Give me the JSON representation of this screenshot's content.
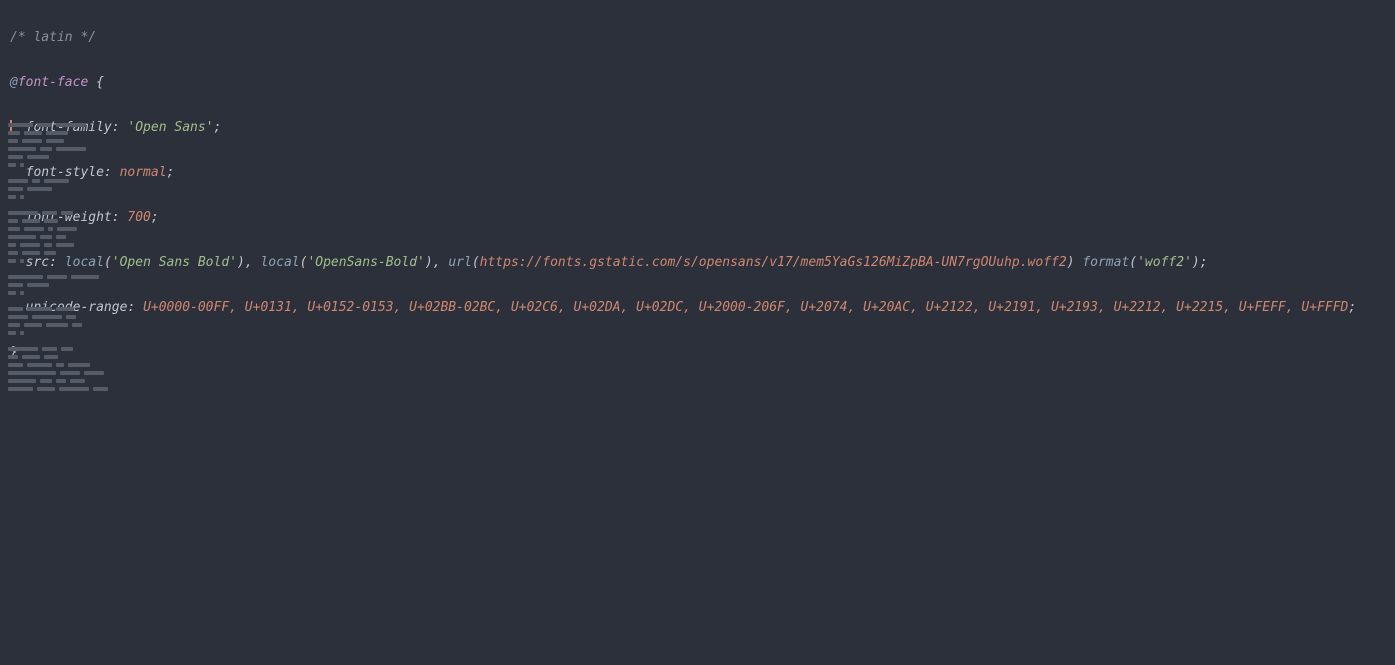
{
  "code": {
    "l1_comment": "/* latin */",
    "l2_at": "@",
    "l2_ff": "font-face",
    "l2_brace": " {",
    "l3_prop": "  font-family",
    "l3_colon": ": ",
    "l3_val": "'Open Sans'",
    "l3_semi": ";",
    "l4_prop": "  font-style",
    "l4_colon": ": ",
    "l4_val": "normal",
    "l4_semi": ";",
    "l5_prop": "  font-weight",
    "l5_colon": ": ",
    "l5_val": "700",
    "l5_semi": ";",
    "l6_prop": "  src",
    "l6_colon": ": ",
    "l6_f1": "local",
    "l6_p1": "(",
    "l6_s1": "'Open Sans Bold'",
    "l6_p2": ")",
    "l6_c1": ", ",
    "l6_f2": "local",
    "l6_p3": "(",
    "l6_s2": "'OpenSans-Bold'",
    "l6_p4": ")",
    "l6_c2": ", ",
    "l6_f3": "url",
    "l6_p5": "(",
    "l6_url": "https://fonts.gstatic.com/s/opensans/v17/mem5YaGs126MiZpBA-UN7rgOUuhp.woff2",
    "l6_p6": ") ",
    "l6_f4": "format",
    "l6_p7": "(",
    "l6_s3": "'woff2'",
    "l6_p8": ")",
    "l6_semi": ";",
    "l7_prop": "  unicode-range",
    "l7_colon": ": ",
    "l7_vals": "U+0000-00FF, U+0131, U+0152-0153, U+02BB-02BC, U+02C6, U+02DA, U+02DC, U+2000-206F, U+2074, U+20AC, U+2122, U+2191, U+2193, U+2212, U+2215, U+FEFF, U+FFFD",
    "l7_semi": ";",
    "l8_brace": "}"
  },
  "minimap_rows": [
    [
      25,
      15,
      30
    ],
    [
      12,
      18,
      22
    ],
    [
      10,
      20,
      18
    ],
    [
      28,
      12,
      30
    ],
    [
      15,
      22
    ],
    [
      8,
      4
    ],
    [],
    [
      20,
      8,
      25
    ],
    [
      15,
      25
    ],
    [
      8,
      4
    ],
    [],
    [
      30,
      15,
      12
    ],
    [
      10,
      18,
      14
    ],
    [
      12,
      20,
      5,
      20
    ],
    [
      28,
      12,
      10
    ],
    [
      8,
      20,
      8,
      18
    ],
    [
      10,
      18,
      12
    ],
    [
      8,
      4
    ],
    [],
    [
      35,
      20,
      28
    ],
    [
      15,
      22
    ],
    [
      8,
      4
    ],
    [],
    [
      15,
      25,
      18
    ],
    [
      20,
      30,
      10
    ],
    [
      12,
      18,
      22,
      10
    ],
    [
      8,
      4
    ],
    [],
    [
      30,
      15,
      12
    ],
    [
      10,
      18,
      14
    ],
    [
      15,
      25,
      8,
      22
    ],
    [
      48,
      20,
      20
    ],
    [
      28,
      12,
      10,
      15
    ],
    [
      25,
      18,
      30,
      15
    ]
  ]
}
